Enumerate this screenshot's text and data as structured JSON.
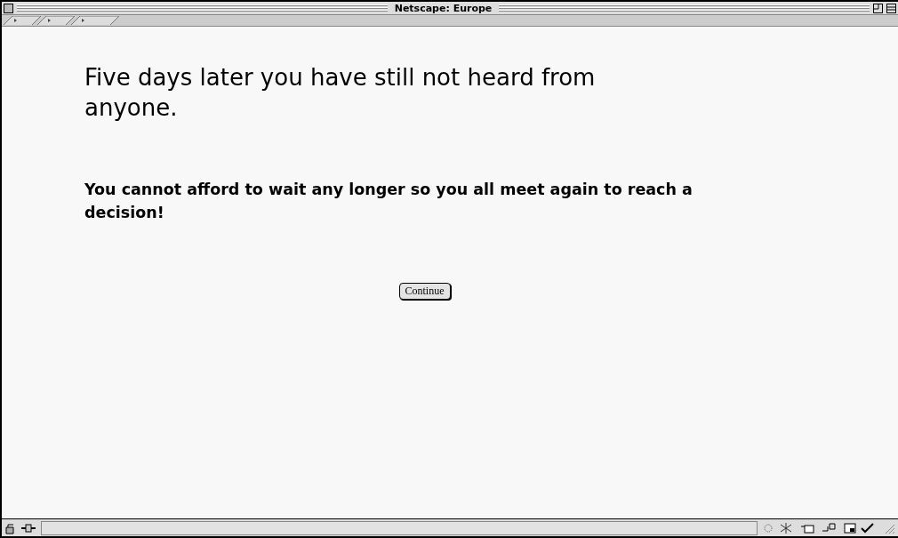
{
  "window": {
    "title": "Netscape: Europe"
  },
  "content": {
    "heading": "Five days later you have still not heard from anyone.",
    "message": "You cannot afford to wait any longer so you all meet again to reach a decision!",
    "button": "Continue"
  }
}
